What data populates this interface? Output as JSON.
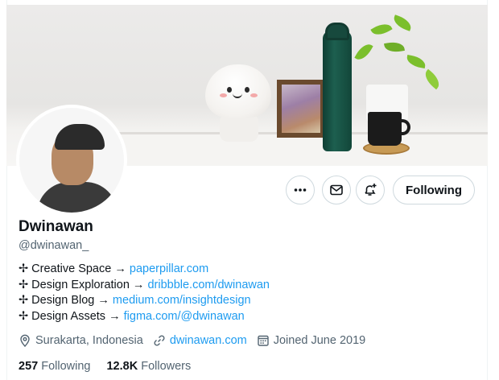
{
  "profile": {
    "display_name": "Dwinawan",
    "handle": "@dwinawan_"
  },
  "actions": {
    "more_icon": "more-icon",
    "message_icon": "mail-icon",
    "notify_icon": "bell-plus-icon",
    "following_label": "Following"
  },
  "bio": [
    {
      "prefix": "✢ Creative Space → ",
      "link": "paperpillar.com"
    },
    {
      "prefix": "✢ Design Exploration → ",
      "link": "dribbble.com/dwinawan"
    },
    {
      "prefix": "✢ Design Blog → ",
      "link": "medium.com/insightdesign"
    },
    {
      "prefix": "✢ Design Assets → ",
      "link": "figma.com/@dwinawan"
    }
  ],
  "meta": {
    "location": "Surakarta, Indonesia",
    "website": "dwinawan.com",
    "joined": "Joined June 2019"
  },
  "stats": {
    "following_count": "257",
    "following_label": "Following",
    "followers_count": "12.8K",
    "followers_label": "Followers"
  },
  "colors": {
    "link": "#1d9bf0",
    "secondary_text": "#536471",
    "primary_text": "#0f1419"
  }
}
